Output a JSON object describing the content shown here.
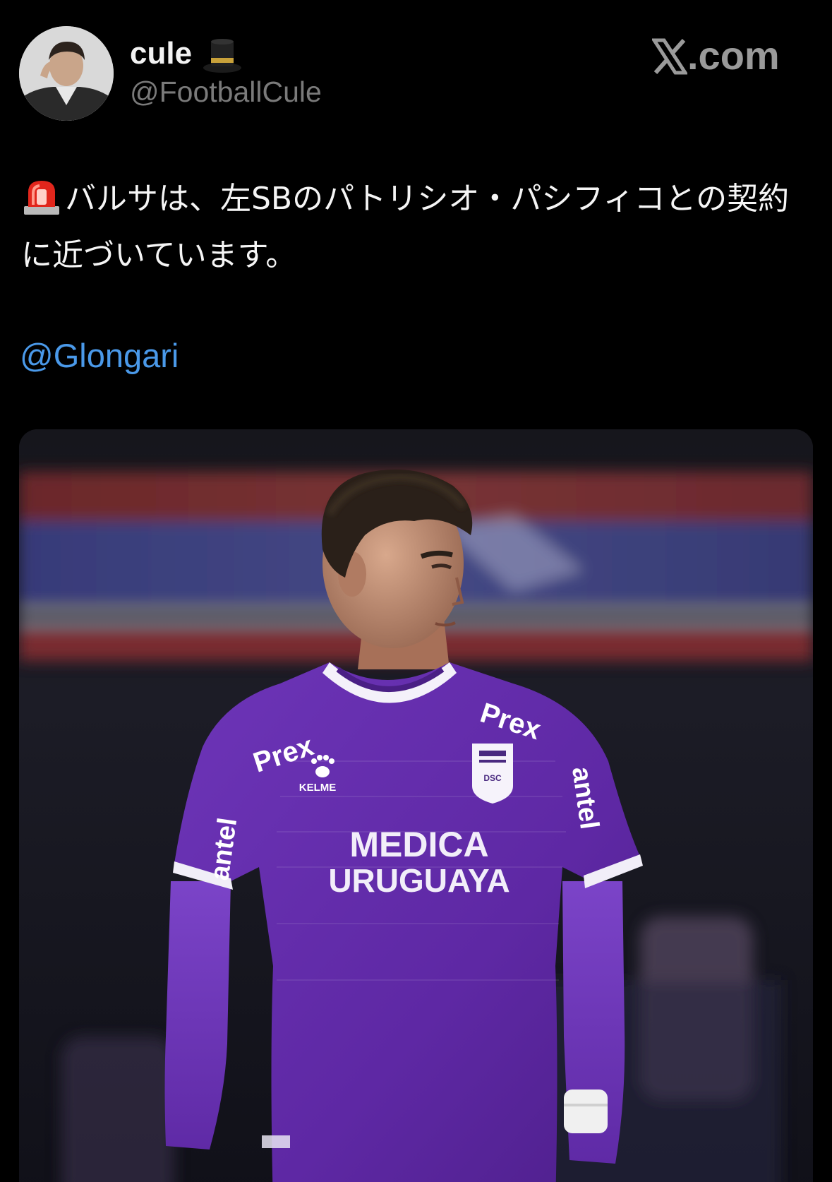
{
  "author": {
    "display_name": "cule",
    "display_name_emoji": "top-hat-icon",
    "handle": "@FootballCule"
  },
  "brand": {
    "label": ".com",
    "logo_icon": "x-logo-icon"
  },
  "tweet": {
    "prefix_icon": "police-siren-icon",
    "text": "バルサは、左SBのパトリシオ・パシフィコとの契約に近づいています。",
    "mention": "@Glongari"
  },
  "media": {
    "kind": "photo",
    "jersey_texts": {
      "sponsor_left": "Prex",
      "sponsor_right": "Prex",
      "kit_brand": "KELME",
      "main_sponsor_line1": "MEDICA",
      "main_sponsor_line2": "URUGUAYA",
      "sleeve_sponsor_left": "antel",
      "sleeve_sponsor_right": "antel",
      "crest": "DSC"
    }
  },
  "colors": {
    "background": "#000000",
    "mention_blue": "#4a99e9",
    "handle_gray": "#7a7a7a",
    "jersey_purple": "#6a2fb0"
  }
}
